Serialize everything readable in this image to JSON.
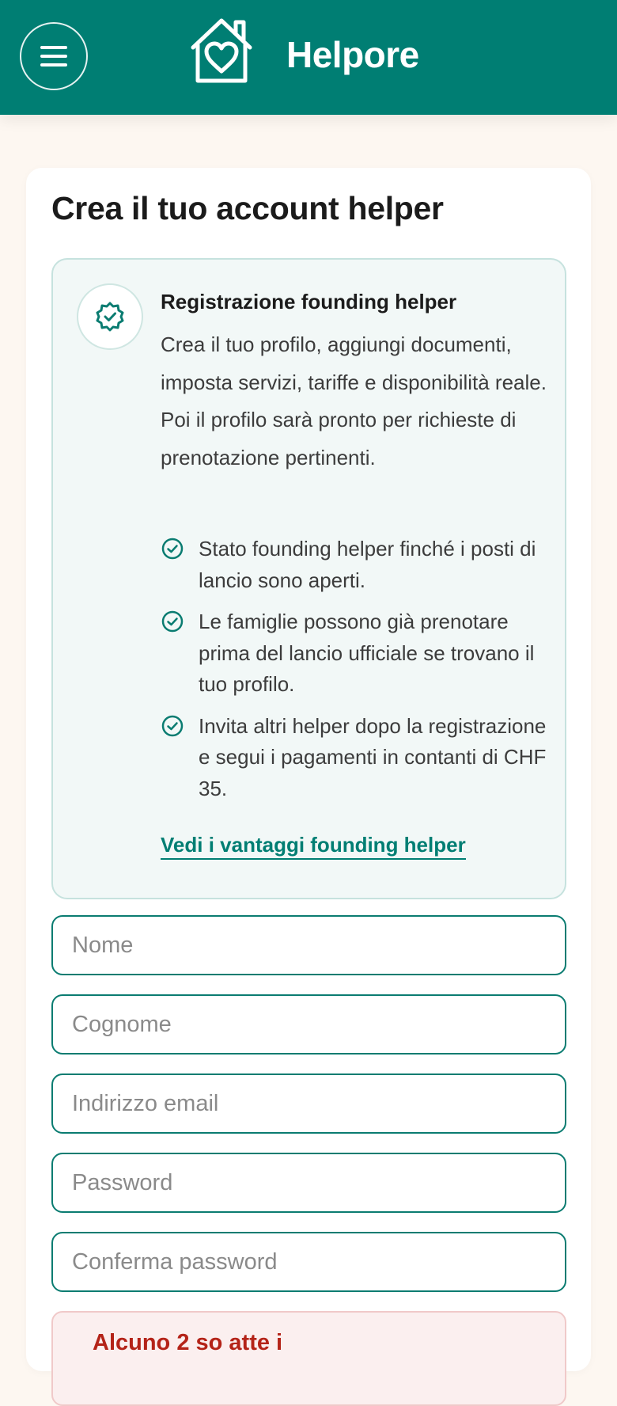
{
  "header": {
    "brand": "Helpore",
    "menu_icon": "hamburger-menu-icon",
    "logo_icon": "house-heart-icon",
    "bg_color": "#007e73"
  },
  "form": {
    "title": "Crea il tuo account helper",
    "info": {
      "badge_icon": "verified-badge-icon",
      "title": "Registrazione founding helper",
      "description": "Crea il tuo profilo, aggiungi documenti, imposta servizi, tariffe e disponibilità reale. Poi il profilo sarà pronto per richieste di prenotazione pertinenti.",
      "benefits": [
        "Stato founding helper finché i posti di lancio sono aperti.",
        "Le famiglie possono già prenotare prima del lancio ufficiale se trovano il tuo profilo.",
        "Invita altri helper dopo la registrazione e segui i pagamenti in contanti di CHF 35."
      ],
      "link": "Vedi i vantaggi founding helper"
    },
    "fields": {
      "first_name": {
        "placeholder": "Nome",
        "value": ""
      },
      "last_name": {
        "placeholder": "Cognome",
        "value": ""
      },
      "email": {
        "placeholder": "Indirizzo email",
        "value": ""
      },
      "password": {
        "placeholder": "Password",
        "value": ""
      },
      "confirm_password": {
        "placeholder": "Conferma password",
        "value": ""
      }
    },
    "alert": {
      "text": "Alcuno 2 so atte i"
    }
  },
  "colors": {
    "accent": "#007e73",
    "page_bg": "#fdf7f1",
    "info_bg": "#f2f8f7",
    "error": "#b42318"
  }
}
